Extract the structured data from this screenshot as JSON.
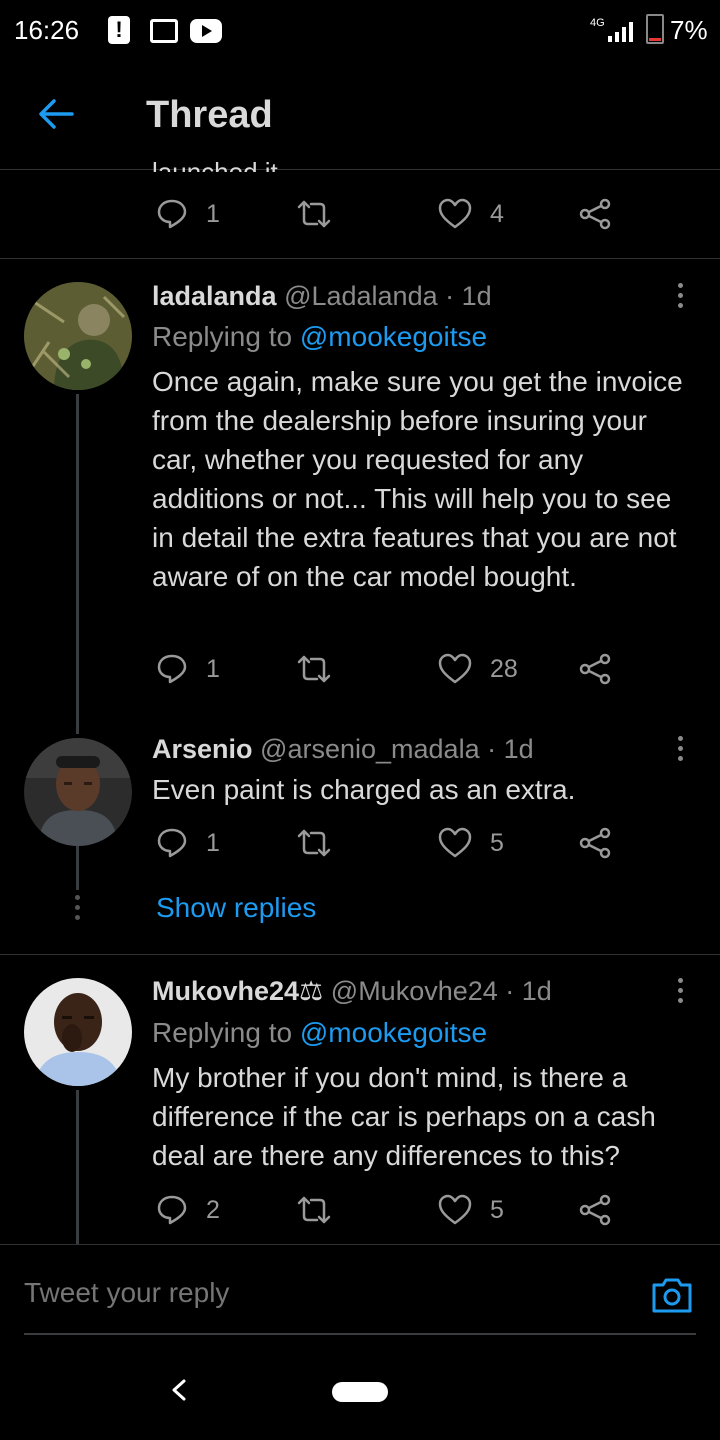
{
  "status_bar": {
    "time": "16:26",
    "network": "4G",
    "battery": "7%",
    "icons": [
      "alert-icon",
      "gallery-icon",
      "youtube-icon",
      "signal-icon",
      "battery-icon"
    ]
  },
  "header": {
    "title": "Thread"
  },
  "previous_tweet": {
    "cut_text": "launched it.",
    "reply_count": "1",
    "retweet_count": "",
    "like_count": "4"
  },
  "tweets": [
    {
      "name": "ladalanda",
      "handle": "@Ladalanda",
      "time": "· 1d",
      "replying_prefix": "Replying to",
      "replying_to": "@mookegoitse",
      "text": "Once again, make sure you get the invoice from the dealership before insuring your car, whether you requested for any additions or not... This will help you to see in detail the extra features that you are not aware of on the car model bought.",
      "reply_count": "1",
      "retweet_count": "",
      "like_count": "28"
    },
    {
      "name": "Arsenio",
      "handle": "@arsenio_madala",
      "time": "· 1d",
      "text": "Even paint is charged as an extra.",
      "reply_count": "1",
      "retweet_count": "",
      "like_count": "5"
    },
    {
      "name": "Mukovhe24⚖",
      "handle": "@Mukovhe24",
      "time": "· 1d",
      "replying_prefix": "Replying to",
      "replying_to": "@mookegoitse",
      "text": "My brother if you don't mind, is there a difference if the car is perhaps on a cash deal are there any differences to this?",
      "reply_count": "2",
      "retweet_count": "",
      "like_count": "5"
    }
  ],
  "show_replies_label": "Show replies",
  "composer": {
    "placeholder": "Tweet your reply"
  },
  "colors": {
    "accent": "#1d9bf0",
    "background": "#000000",
    "text": "#d9d9d9",
    "muted": "#8b8b8b"
  }
}
